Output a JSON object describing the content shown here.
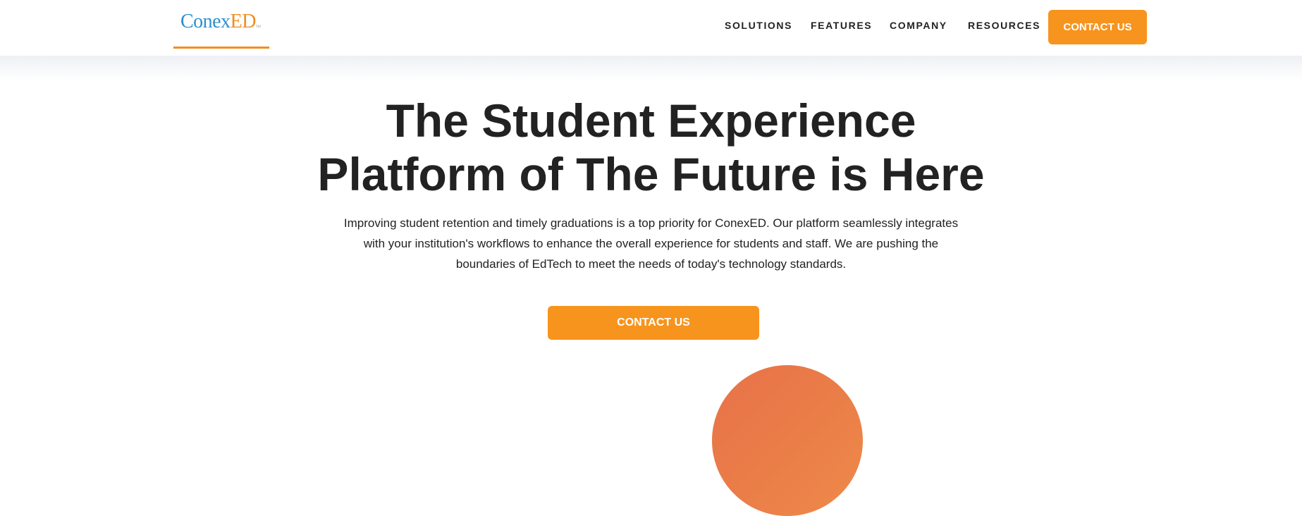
{
  "header": {
    "logo_main": "Conex",
    "logo_accent": "ED",
    "logo_tm": "TM",
    "nav": [
      {
        "label": "SOLUTIONS"
      },
      {
        "label": "FEATURES"
      },
      {
        "label": "COMPANY"
      },
      {
        "label": "RESOURCES"
      }
    ],
    "cta_label": "CONTACT US"
  },
  "hero": {
    "title_lines": [
      "The Student Experience",
      "Platform of The Future is Here"
    ],
    "description_lines": [
      "Improving student retention and timely graduations is a top priority for ConexED. Our platform seamlessly integrates",
      "with your institution's workflows to enhance the overall experience for students and staff. We are pushing the",
      "boundaries of EdTech to meet the needs of today's technology standards."
    ],
    "cta_label": "CONTACT US"
  },
  "colors": {
    "accent_orange": "#f7941d",
    "logo_blue": "#2b8fd0",
    "logo_orange": "#f28d20",
    "circle_orange": "#e8764a",
    "text_dark": "#222222"
  }
}
